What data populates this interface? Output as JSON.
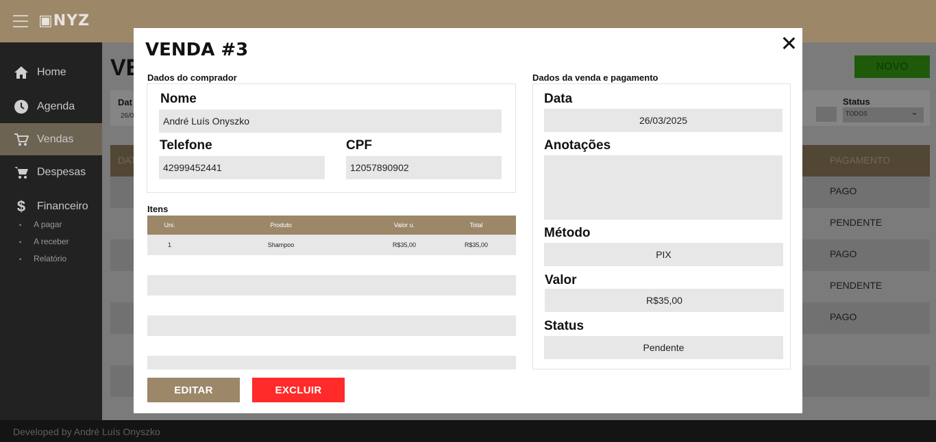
{
  "app": {
    "logo": "▣NYZ",
    "page_title": "VE",
    "new_button": "NOVO",
    "sidebar": {
      "items": [
        {
          "label": "Home",
          "icon": "home-icon"
        },
        {
          "label": "Agenda",
          "icon": "clock-icon"
        },
        {
          "label": "Vendas",
          "icon": "cart-icon"
        },
        {
          "label": "Despesas",
          "icon": "cart-icon"
        },
        {
          "label": "Financeiro",
          "icon": "dollar-icon"
        }
      ],
      "sub_items": [
        "A pagar",
        "A receber",
        "Relatório"
      ]
    },
    "filters": {
      "date_label": "Dat",
      "date_value": "26/0",
      "status_label": "Status",
      "status_value": "TODOS"
    },
    "table": {
      "first_header": "DAT",
      "payment_header": "PAGAMENTO",
      "payment_values": [
        "PAGO",
        "PENDENTE",
        "PAGO",
        "PENDENTE",
        "PAGO"
      ]
    },
    "footer": "Developed by André Luís Onyszko"
  },
  "modal": {
    "title": "VENDA #3",
    "buyer": {
      "section_title": "Dados do comprador",
      "name_label": "Nome",
      "name": "André Luís Onyszko",
      "phone_label": "Telefone",
      "phone": "42999452441",
      "cpf_label": "CPF",
      "cpf": "12057890902"
    },
    "items": {
      "section_title": "Itens",
      "headers": [
        "Uni.",
        "Produto",
        "Valor u.",
        "Total"
      ],
      "rows": [
        {
          "uni": "1",
          "produto": "Shampoo",
          "valor": "R$35,00",
          "total": "R$35,00"
        }
      ]
    },
    "sale": {
      "section_title": "Dados da venda e pagamento",
      "date_label": "Data",
      "date": "26/03/2025",
      "notes_label": "Anotações",
      "notes": "",
      "method_label": "Método",
      "method": "PIX",
      "value_label": "Valor",
      "value": "R$35,00",
      "status_label": "Status",
      "status": "Pendente"
    },
    "buttons": {
      "edit": "EDITAR",
      "delete": "EXCLUIR"
    }
  }
}
